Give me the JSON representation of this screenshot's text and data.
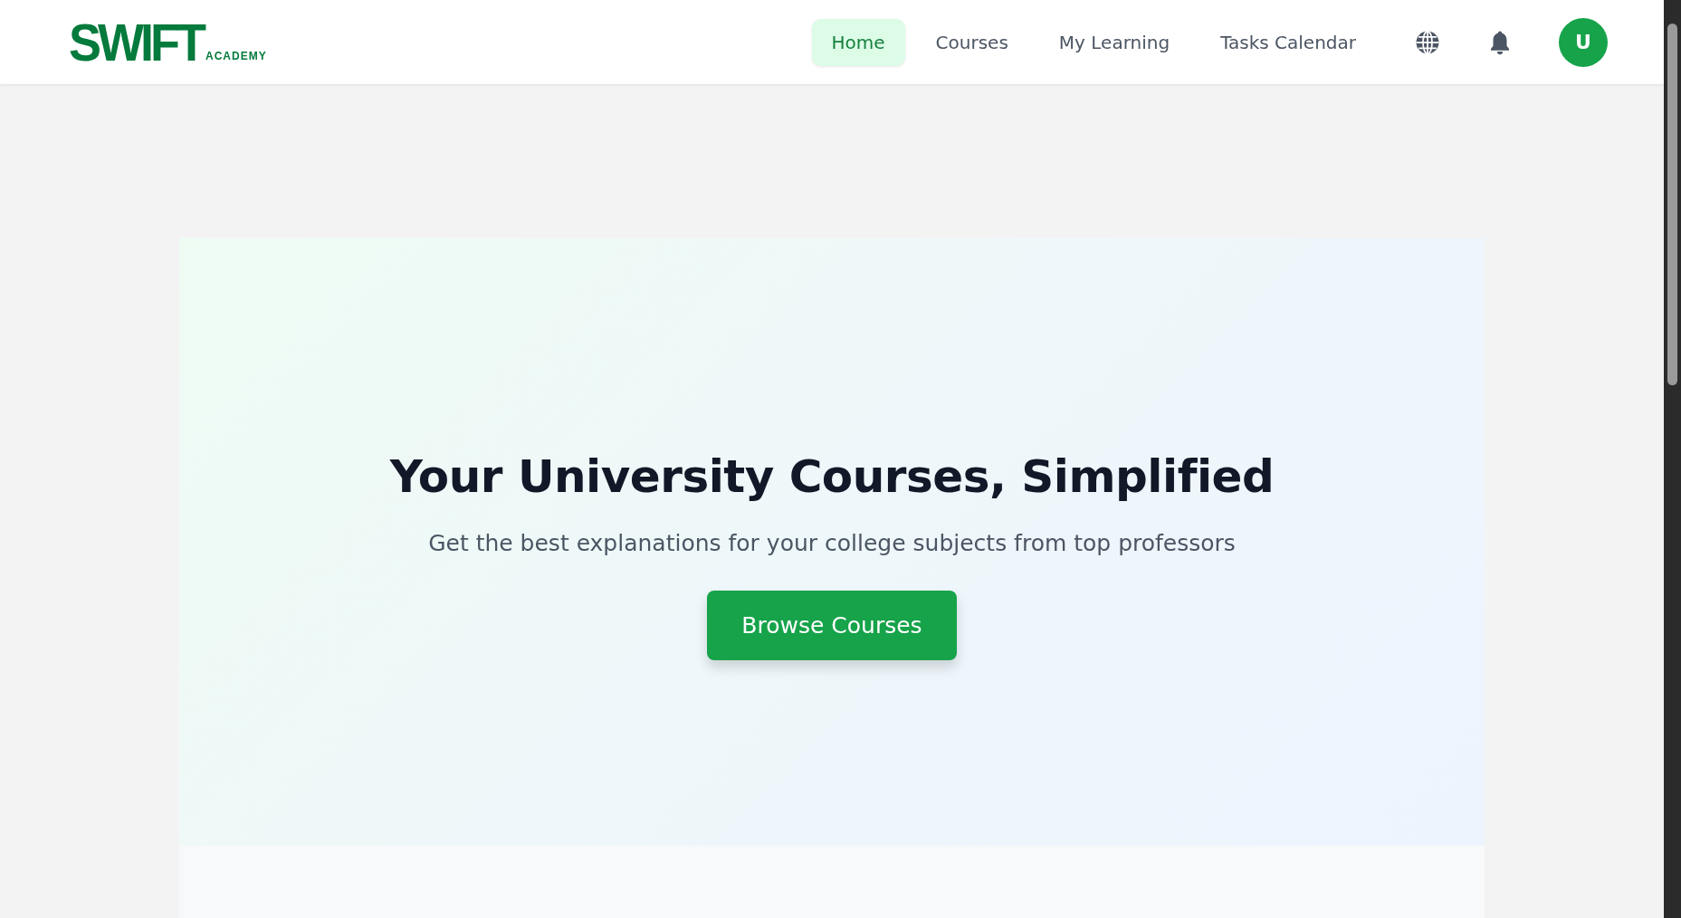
{
  "logo": {
    "name": "SWIFT",
    "tagline": "ACADEMY"
  },
  "nav": [
    {
      "label": "Home",
      "selected": true
    },
    {
      "label": "Courses",
      "selected": false
    },
    {
      "label": "My Learning",
      "selected": false
    },
    {
      "label": "Tasks Calendar",
      "selected": false
    }
  ],
  "avatar": {
    "initial": "U"
  },
  "hero": {
    "title": "Your University Courses, Simplified",
    "subtitle": "Get the best explanations for your college subjects from top professors",
    "button": "Browse Courses"
  }
}
